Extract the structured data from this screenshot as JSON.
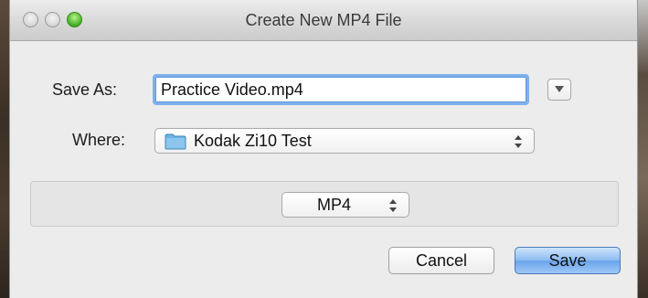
{
  "window": {
    "title": "Create New MP4 File"
  },
  "form": {
    "save_as_label": "Save As:",
    "save_as_value": "Practice Video.mp4",
    "where_label": "Where:",
    "where_value": "Kodak Zi10 Test"
  },
  "format": {
    "selected": "MP4"
  },
  "buttons": {
    "cancel": "Cancel",
    "save": "Save"
  },
  "icons": {
    "close": "close-button-icon",
    "minimize": "minimize-button-icon",
    "zoom": "zoom-button-icon",
    "disclosure": "triangle-down-icon",
    "folder": "folder-icon",
    "updown": "updown-arrows-icon"
  },
  "colors": {
    "focus_ring": "#7fb1ec",
    "default_button": "#6aa5ec",
    "zoom_green": "#3fae23",
    "folder_blue": "#6fb2e0"
  }
}
